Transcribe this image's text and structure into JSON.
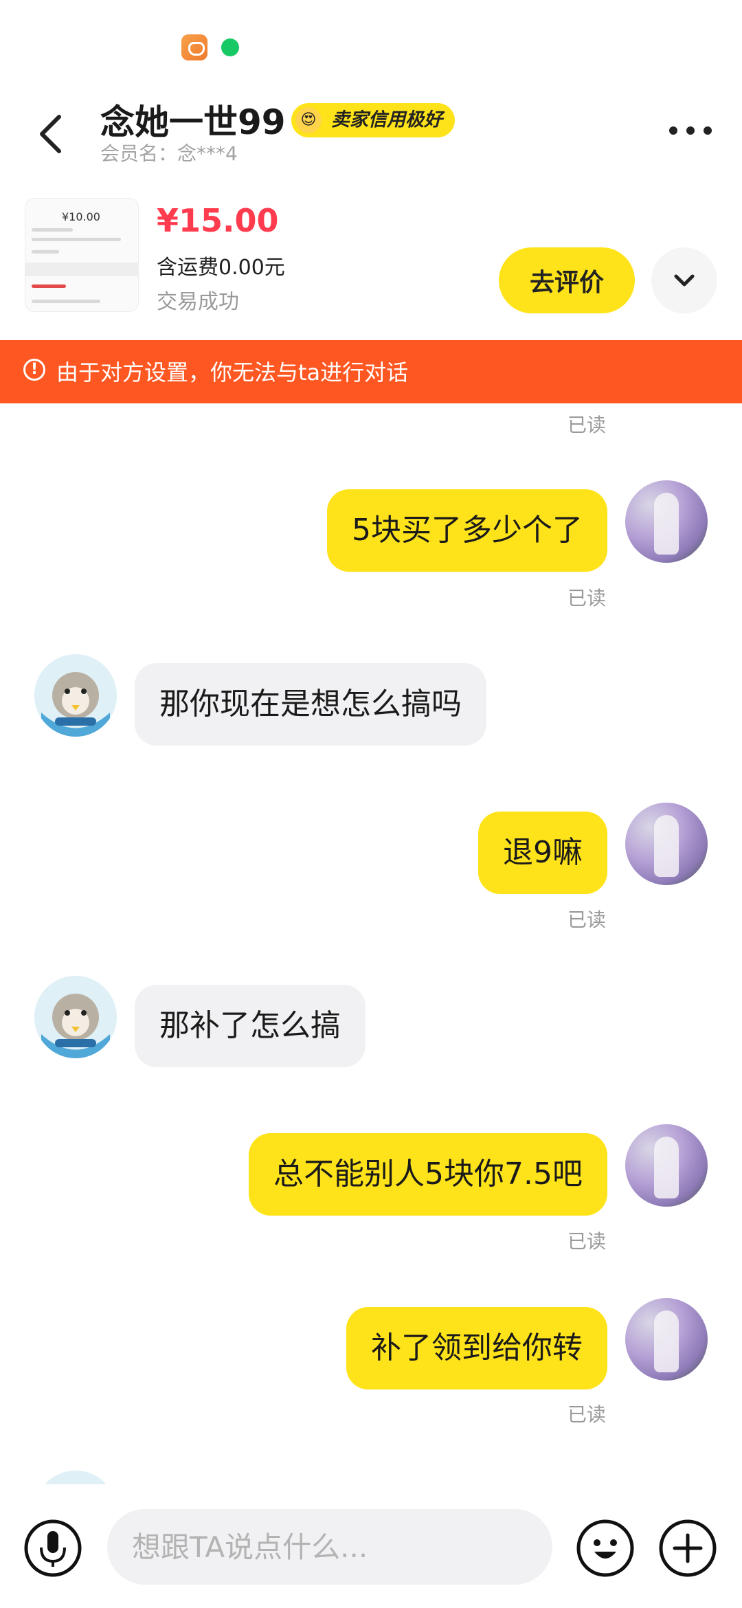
{
  "header": {
    "title": "念她一世99",
    "badge": "卖家信用极好",
    "member": "会员名：念***4"
  },
  "product": {
    "thumb_price": "¥10.00",
    "price": "¥15.00",
    "shipping": "含运费0.00元",
    "status": "交易成功",
    "review_button": "去评价"
  },
  "banner": {
    "text": "由于对方设置，你无法与ta进行对话"
  },
  "chat": {
    "read_label": "已读",
    "messages": [
      {
        "from": "me",
        "text": "5块买了多少个了"
      },
      {
        "from": "them",
        "text": "那你现在是想怎么搞吗"
      },
      {
        "from": "me",
        "text": "退9嘛"
      },
      {
        "from": "them",
        "text": "那补了怎么搞"
      },
      {
        "from": "me",
        "text": "总不能别人5块你7.5吧"
      },
      {
        "from": "me",
        "text": "补了领到给你转"
      }
    ]
  },
  "input": {
    "placeholder": "想跟TA说点什么..."
  },
  "colors": {
    "accent": "#ffe31a",
    "price": "#ff3b4e",
    "banner": "#ff5722"
  }
}
